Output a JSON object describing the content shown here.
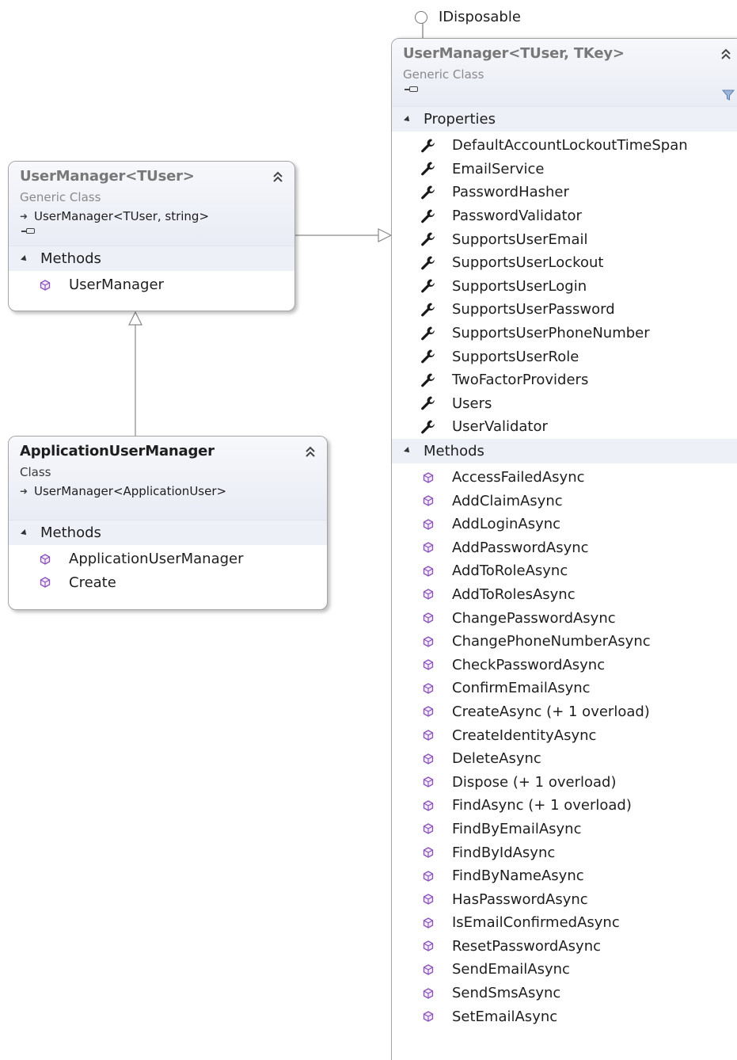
{
  "interface": {
    "name": "IDisposable"
  },
  "classes": {
    "user_manager_tkey": {
      "name": "UserManager<TUser, TKey>",
      "kind": "Generic Class",
      "sections": [
        {
          "title": "Properties",
          "members": [
            "DefaultAccountLockoutTimeSpan",
            "EmailService",
            "PasswordHasher",
            "PasswordValidator",
            "SupportsUserEmail",
            "SupportsUserLockout",
            "SupportsUserLogin",
            "SupportsUserPassword",
            "SupportsUserPhoneNumber",
            "SupportsUserRole",
            "TwoFactorProviders",
            "Users",
            "UserValidator"
          ]
        },
        {
          "title": "Methods",
          "members": [
            "AccessFailedAsync",
            "AddClaimAsync",
            "AddLoginAsync",
            "AddPasswordAsync",
            "AddToRoleAsync",
            "AddToRolesAsync",
            "ChangePasswordAsync",
            "ChangePhoneNumberAsync",
            "CheckPasswordAsync",
            "ConfirmEmailAsync",
            "CreateAsync (+ 1 overload)",
            "CreateIdentityAsync",
            "DeleteAsync",
            "Dispose (+ 1 overload)",
            "FindAsync (+ 1 overload)",
            "FindByEmailAsync",
            "FindByIdAsync",
            "FindByNameAsync",
            "HasPasswordAsync",
            "IsEmailConfirmedAsync",
            "ResetPasswordAsync",
            "SendEmailAsync",
            "SendSmsAsync",
            "SetEmailAsync"
          ]
        }
      ]
    },
    "user_manager_tuser": {
      "name": "UserManager<TUser>",
      "kind": "Generic Class",
      "base": "UserManager<TUser, string>",
      "sections": [
        {
          "title": "Methods",
          "members": [
            "UserManager"
          ]
        }
      ]
    },
    "application_user_manager": {
      "name": "ApplicationUserManager",
      "kind": "Class",
      "base": "UserManager<ApplicationUser>",
      "sections": [
        {
          "title": "Methods",
          "members": [
            "ApplicationUserManager",
            "Create"
          ]
        }
      ]
    }
  },
  "icons": {
    "property": "wrench-icon",
    "method": "method-cube-icon",
    "collapse": "double-chevron-up-icon",
    "filter": "filter-icon",
    "pin": "pin-icon",
    "base_type": "inheritance-arrow-icon",
    "interface": "lollipop-interface-icon"
  },
  "colors": {
    "header_bg": "#eceff6",
    "section_bg": "#edf0f7",
    "border": "#a4a4a4",
    "generic_name": "#787878",
    "method_icon": "#8a4fb8"
  }
}
